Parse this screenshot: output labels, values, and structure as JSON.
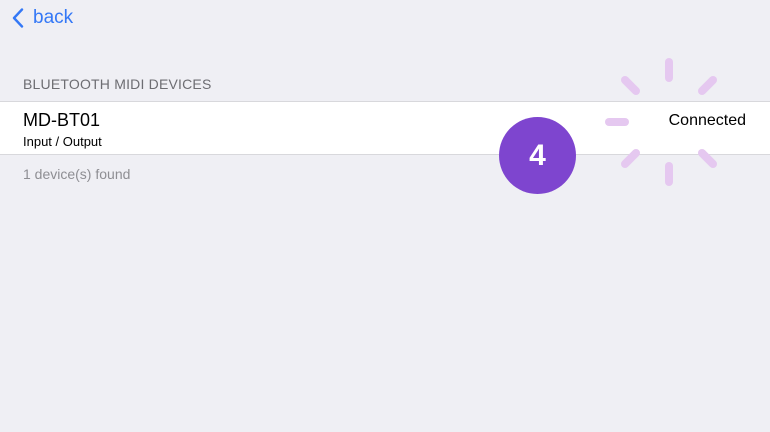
{
  "nav": {
    "back_label": "back",
    "back_icon": "chevron-left-icon",
    "accent_color": "#3478f6"
  },
  "section": {
    "header": "BLUETOOTH MIDI DEVICES"
  },
  "devices": [
    {
      "name": "MD-BT01",
      "io": "Input / Output",
      "status": "Connected"
    }
  ],
  "footer": {
    "found_text": "1 device(s) found"
  },
  "overlay": {
    "step_number": "4",
    "step_color": "#7e45cf",
    "tap_indicator_icon": "tap-burst-icon",
    "tap_indicator_color": "#e5c8f0"
  }
}
